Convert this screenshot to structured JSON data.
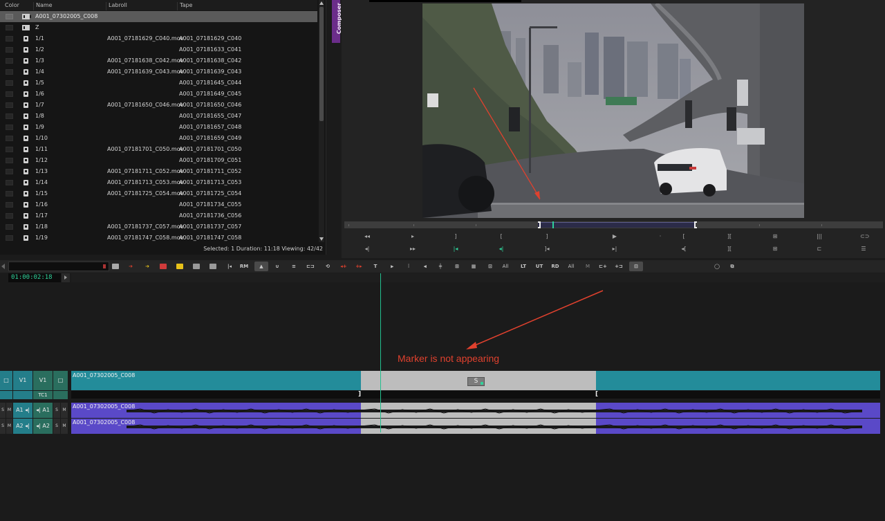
{
  "bin": {
    "columns": [
      "Color",
      "Name",
      "Labroll",
      "Tape"
    ],
    "rows": [
      {
        "name": "A001_07302005_C008",
        "labroll": "",
        "tape": "",
        "type": "sequence",
        "selected": true
      },
      {
        "name": "Z",
        "labroll": "",
        "tape": "",
        "type": "sequence"
      },
      {
        "name": "1/1",
        "labroll": "A001_07181629_C040.mov",
        "tape": "A001_07181629_C040",
        "type": "clip"
      },
      {
        "name": "1/2",
        "labroll": "",
        "tape": "A001_07181633_C041",
        "type": "clip"
      },
      {
        "name": "1/3",
        "labroll": "A001_07181638_C042.mov",
        "tape": "A001_07181638_C042",
        "type": "clip"
      },
      {
        "name": "1/4",
        "labroll": "A001_07181639_C043.mov",
        "tape": "A001_07181639_C043",
        "type": "clip"
      },
      {
        "name": "1/5",
        "labroll": "",
        "tape": "A001_07181645_C044",
        "type": "clip"
      },
      {
        "name": "1/6",
        "labroll": "",
        "tape": "A001_07181649_C045",
        "type": "clip"
      },
      {
        "name": "1/7",
        "labroll": "A001_07181650_C046.mov",
        "tape": "A001_07181650_C046",
        "type": "clip"
      },
      {
        "name": "1/8",
        "labroll": "",
        "tape": "A001_07181655_C047",
        "type": "clip"
      },
      {
        "name": "1/9",
        "labroll": "",
        "tape": "A001_07181657_C048",
        "type": "clip"
      },
      {
        "name": "1/10",
        "labroll": "",
        "tape": "A001_07181659_C049",
        "type": "clip"
      },
      {
        "name": "1/11",
        "labroll": "A001_07181701_C050.mov",
        "tape": "A001_07181701_C050",
        "type": "clip"
      },
      {
        "name": "1/12",
        "labroll": "",
        "tape": "A001_07181709_C051",
        "type": "clip"
      },
      {
        "name": "1/13",
        "labroll": "A001_07181711_C052.mov",
        "tape": "A001_07181711_C052",
        "type": "clip"
      },
      {
        "name": "1/14",
        "labroll": "A001_07181713_C053.mov",
        "tape": "A001_07181713_C053",
        "type": "clip"
      },
      {
        "name": "1/15",
        "labroll": "A001_07181725_C054.mov",
        "tape": "A001_07181725_C054",
        "type": "clip"
      },
      {
        "name": "1/16",
        "labroll": "",
        "tape": "A001_07181734_C055",
        "type": "clip"
      },
      {
        "name": "1/17",
        "labroll": "",
        "tape": "A001_07181736_C056",
        "type": "clip"
      },
      {
        "name": "1/18",
        "labroll": "A001_07181737_C057.mov",
        "tape": "A001_07181737_C057",
        "type": "clip"
      },
      {
        "name": "1/19",
        "labroll": "A001_07181747_C058.mov",
        "tape": "A001_07181747_C058",
        "type": "clip"
      }
    ],
    "status": "Selected: 1  Duration: 11:18  Viewing: 42/42"
  },
  "composer": {
    "tab_label": "Composer"
  },
  "toolbar": {
    "rm": "RM",
    "all1": "All",
    "lt": "LT",
    "ut": "UT",
    "rd": "RD",
    "all2": "All",
    "m": "M"
  },
  "timecode": "01:00:02:18",
  "tracks": {
    "v1_source": "V1",
    "v1_record": "V1",
    "tc1": "TC1",
    "a1_source": "A1",
    "a1_record": "A1",
    "a2_source": "A2",
    "a2_record": "A2",
    "solo": "S",
    "mute": "M"
  },
  "clips": {
    "video_clip": "A001_07302005_C008",
    "audio1_clip": "A001_07302005_C008",
    "audio2_clip": "A001_07302005_C008",
    "s_chip": "S"
  },
  "annotation": {
    "text": "Marker is not appearing",
    "color": "#e0412e"
  },
  "colors": {
    "video_track": "#238c9a",
    "audio_track": "#5a49c8",
    "selected_segment": "#bdbdbd",
    "playhead": "#23c08e",
    "composer_tab": "#6b2d8a"
  }
}
